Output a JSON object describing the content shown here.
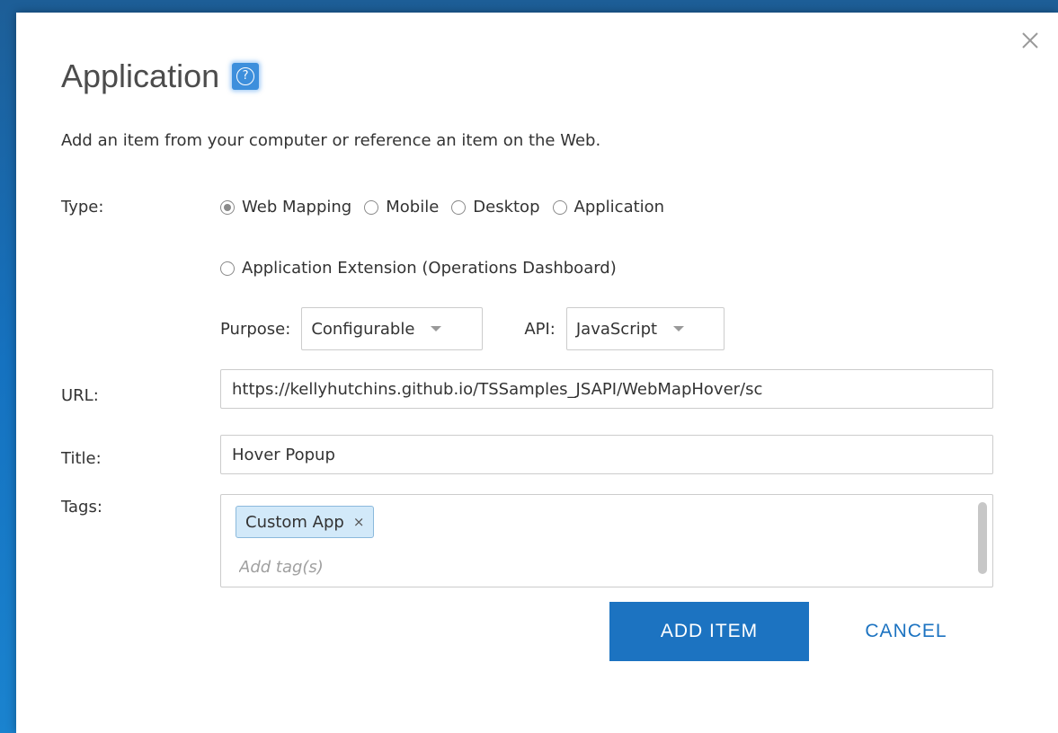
{
  "dialog": {
    "title": "Application",
    "help_icon": "question-mark-icon",
    "close_icon": "close-icon",
    "subtitle": "Add an item from your computer or reference an item on the Web."
  },
  "form": {
    "type_label": "Type:",
    "type_options": [
      {
        "label": "Web Mapping",
        "checked": true
      },
      {
        "label": "Mobile",
        "checked": false
      },
      {
        "label": "Desktop",
        "checked": false
      },
      {
        "label": "Application",
        "checked": false
      },
      {
        "label": "Application Extension (Operations Dashboard)",
        "checked": false
      }
    ],
    "purpose_label": "Purpose:",
    "purpose_value": "Configurable",
    "api_label": "API:",
    "api_value": "JavaScript",
    "url_label": "URL:",
    "url_value": "https://kellyhutchins.github.io/TSSamples_JSAPI/WebMapHover/sc",
    "title_label": "Title:",
    "title_value": "Hover Popup",
    "tags_label": "Tags:",
    "tags": [
      {
        "label": "Custom App",
        "remove": "×"
      }
    ],
    "tags_placeholder": "Add tag(s)"
  },
  "actions": {
    "add_label": "ADD ITEM",
    "cancel_label": "CANCEL"
  },
  "colors": {
    "accent": "#1c73c1",
    "tag_background": "#d2e9f9",
    "help_icon_bg": "#3d8fdc"
  }
}
